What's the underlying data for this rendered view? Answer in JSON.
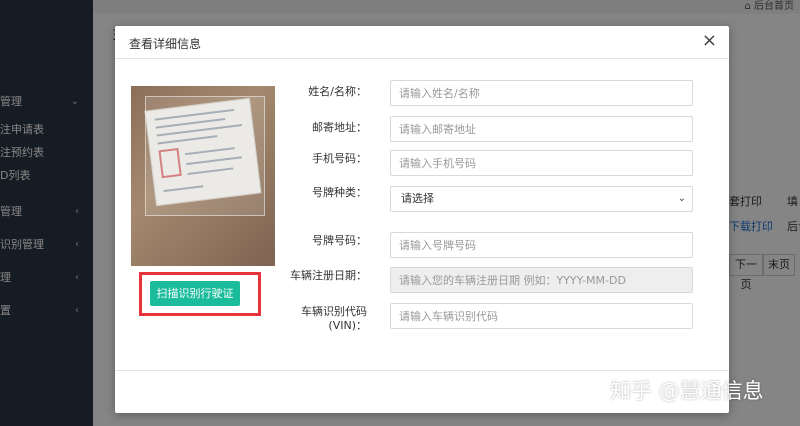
{
  "background": {
    "breadcrumb": "⌂ 后台首页",
    "sidebar": {
      "items": [
        {
          "label": "管理"
        },
        {
          "label": "注申请表"
        },
        {
          "label": "注预约表"
        },
        {
          "label": "D列表"
        },
        {
          "label": "管理"
        },
        {
          "label": "识别管理"
        },
        {
          "label": "理"
        },
        {
          "label": "置"
        }
      ]
    },
    "table": {
      "col_print": "套打印",
      "col_fill": "填",
      "cell_download": "下载打印",
      "cell_partial": "后台"
    },
    "pager": {
      "next": "下一页",
      "last": "末页"
    },
    "partial_icon_text": "Ξ"
  },
  "modal": {
    "title": "查看详细信息",
    "close_label": "×",
    "scan_button": "扫描识别行驶证",
    "fields": {
      "name": {
        "label": "姓名/名称：",
        "placeholder": "请输入姓名/名称"
      },
      "address": {
        "label": "邮寄地址：",
        "placeholder": "请输入邮寄地址"
      },
      "phone": {
        "label": "手机号码：",
        "placeholder": "请输入手机号码"
      },
      "plate_type": {
        "label": "号牌种类：",
        "value": "请选择"
      },
      "plate_number": {
        "label": "号牌号码：",
        "placeholder": "请输入号牌号码"
      },
      "register_date": {
        "label": "车辆注册日期：",
        "placeholder": "请输入您的车辆注册日期 例如：YYYY-MM-DD"
      },
      "vin": {
        "label": "车辆识别代码",
        "label_sub": "(VIN)：",
        "placeholder": "请输入车辆识别代码"
      }
    }
  },
  "watermark": "知乎 @慧通信息",
  "colors": {
    "accent": "#1abc9c",
    "highlight": "#e8333c",
    "sidebar": "#2b3643"
  }
}
